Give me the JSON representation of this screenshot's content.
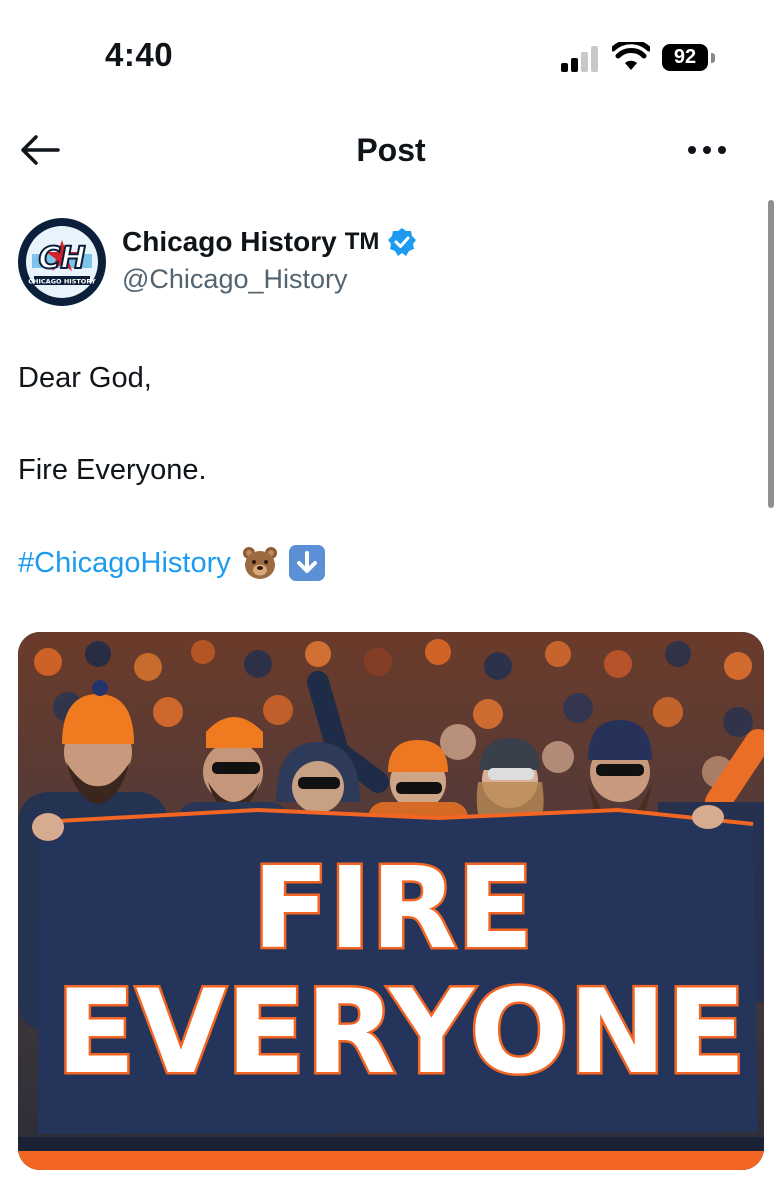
{
  "status_bar": {
    "time": "4:40",
    "battery": "92",
    "icons": [
      "signal-icon",
      "wifi-icon",
      "battery-icon"
    ]
  },
  "header": {
    "title": "Post",
    "back_icon": "back-arrow-icon",
    "more_icon": "more-icon"
  },
  "post": {
    "author": {
      "name": "Chicago History",
      "trademark": "TM",
      "handle": "@Chicago_History",
      "verified": true,
      "avatar_text": "CH",
      "avatar_subtext": "CHICAGO HISTORY"
    },
    "text": {
      "line1": "Dear God,",
      "line2": "Fire Everyone.",
      "hashtag": "#ChicagoHistory"
    },
    "emojis": [
      "bear-emoji",
      "down-arrow-emoji"
    ],
    "media": {
      "banner_line1": "FIRE",
      "banner_line2": "EVERYONE"
    }
  },
  "colors": {
    "link": "#1d9bf0",
    "secondary_text": "#536471",
    "banner_navy": "#24345a",
    "banner_orange": "#f26522"
  }
}
